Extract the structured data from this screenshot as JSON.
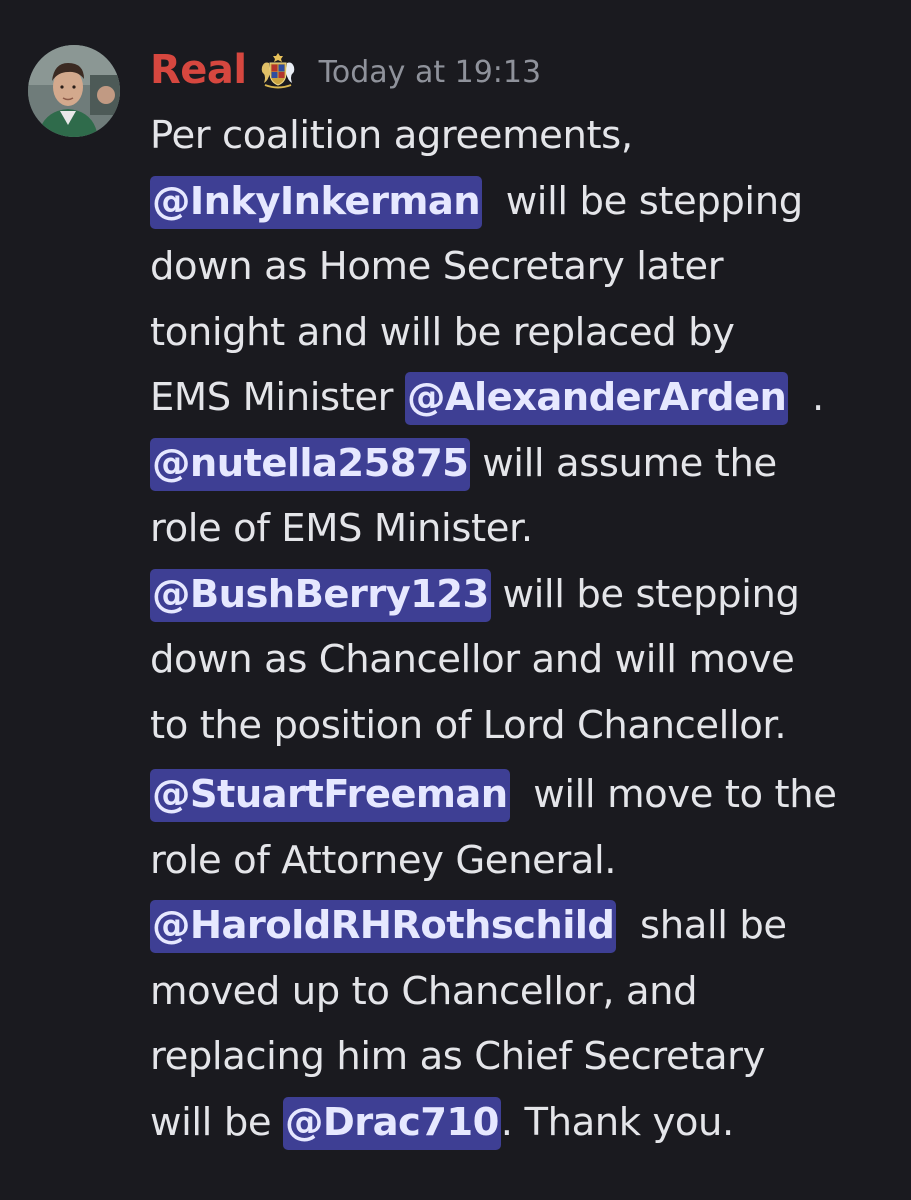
{
  "message": {
    "author": "Real",
    "role_icon": "royal-coat-of-arms-icon",
    "timestamp": "Today at 19:13",
    "lines": [
      {
        "parts": [
          "Per coalition agreements,"
        ]
      },
      {
        "mention": "@InkyInkerman",
        "text": "  will be stepping"
      },
      {
        "parts": [
          "down as Home Secretary later"
        ]
      },
      {
        "parts": [
          "tonight and will be replaced by"
        ]
      },
      {
        "pre": "EMS Minister ",
        "mention": "@AlexanderArden",
        "text": "  ."
      },
      {
        "mention": "@nutella25875",
        "text": " will assume the"
      },
      {
        "parts": [
          "role of EMS Minister."
        ]
      },
      {
        "mention": "@BushBerry123",
        "text": " will be stepping"
      },
      {
        "parts": [
          "down as Chancellor and will move"
        ]
      },
      {
        "parts": [
          "to the position of Lord Chancellor."
        ]
      },
      {
        "mention": "@StuartFreeman",
        "text": "  will move to the"
      },
      {
        "parts": [
          "role of Attorney General."
        ]
      },
      {
        "mention": "@HaroldRHRothschild",
        "text": "  shall be"
      },
      {
        "parts": [
          "moved up to Chancellor, and"
        ]
      },
      {
        "parts": [
          "replacing him as Chief Secretary"
        ]
      },
      {
        "pre": "will be ",
        "mention": "@Drac710",
        "text": ". Thank you."
      }
    ]
  },
  "colors": {
    "background": "#1a1a1f",
    "username": "#d6473f",
    "timestamp": "#8f929b",
    "text": "#e4e5e9",
    "mention_bg": "#3e3f94"
  }
}
